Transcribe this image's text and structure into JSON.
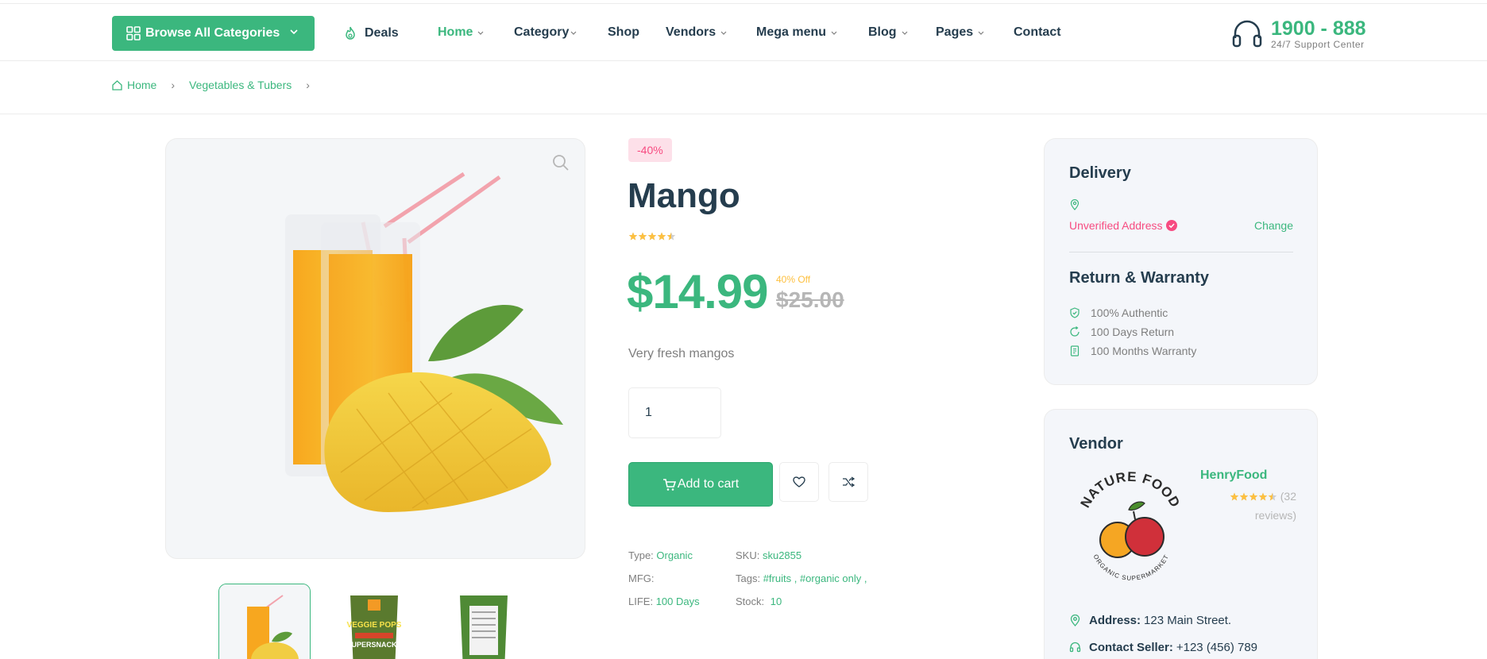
{
  "header": {
    "browse_label": "Browse  All Categories",
    "nav": [
      {
        "label": "Deals"
      },
      {
        "label": "Home"
      },
      {
        "label": "Category"
      },
      {
        "label": "Shop"
      },
      {
        "label": "Vendors"
      },
      {
        "label": "Mega menu"
      },
      {
        "label": "Blog"
      },
      {
        "label": "Pages"
      },
      {
        "label": "Contact"
      }
    ],
    "support_phone": "1900 - 888",
    "support_label": "24/7 Support Center"
  },
  "breadcrumb": {
    "home": "Home",
    "category": "Vegetables & Tubers",
    "separator": "›"
  },
  "product": {
    "discount_badge": "-40%",
    "title": "Mango",
    "rating_fraction": 0.9,
    "price": "$14.99",
    "off_label": "40% Off",
    "old_price": "$25.00",
    "description": "Very fresh mangos",
    "quantity": "1",
    "add_to_cart": "Add to cart",
    "meta": {
      "type_label": "Type:",
      "type_value": "Organic",
      "mfg_label": "MFG:",
      "life_label": "LIFE:",
      "life_value": "100 Days",
      "sku_label": "SKU:",
      "sku_value": "sku2855",
      "tags_label": "Tags:",
      "tags_value": "#fruits , #organic only ,",
      "stock_label": "Stock:",
      "stock_value": "10"
    }
  },
  "delivery": {
    "title": "Delivery",
    "unverified": "Unverified Address",
    "change": "Change",
    "return_title": "Return & Warranty",
    "items": [
      "100% Authentic",
      "100 Days Return",
      "100 Months Warranty"
    ]
  },
  "vendor": {
    "title": "Vendor",
    "name": "HenryFood",
    "reviews": "(32 reviews)",
    "rating_fraction": 0.9,
    "logo_text": "NATURE FOOD",
    "logo_subtext": "ORGANIC SUPERMARKET",
    "address_label": "Address:",
    "address_value": "123 Main Street.",
    "contact_label": "Contact Seller:",
    "contact_value": "+123 (456) 789"
  },
  "thumbs": {
    "pack_text_1": "VEGGIE POPS",
    "pack_text_2": "SUPERSNACKS"
  },
  "colors": {
    "brand": "#3bb77e",
    "heading": "#253d4e",
    "muted": "#7e7e7e",
    "sale": "#f74b81",
    "star": "#fdc040"
  }
}
